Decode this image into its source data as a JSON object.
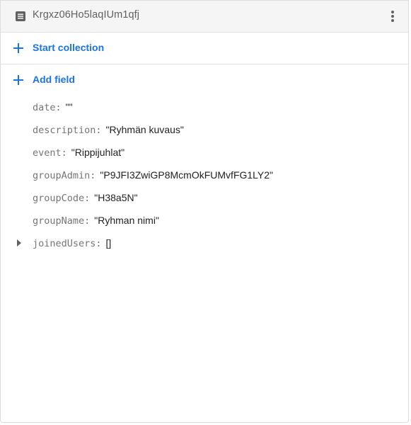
{
  "document": {
    "id": "Krgxz06Ho5laqIUm1qfj"
  },
  "actions": {
    "start_collection": "Start collection",
    "add_field": "Add field"
  },
  "fields": [
    {
      "key": "date:",
      "value": "\"\""
    },
    {
      "key": "description:",
      "value": "\"Ryhmän kuvaus\""
    },
    {
      "key": "event:",
      "value": "\"Rippijuhlat\""
    },
    {
      "key": "groupAdmin:",
      "value": "\"P9JFI3ZwiGP8McmOkFUMvfFG1LY2\""
    },
    {
      "key": "groupCode:",
      "value": "\"H38a5N\""
    },
    {
      "key": "groupName:",
      "value": "\"Ryhman nimi\""
    },
    {
      "key": "joinedUsers:",
      "value": "[]",
      "expandable": true
    }
  ],
  "colors": {
    "accent": "#1a73e8",
    "key_text": "#757575",
    "value_text": "#212121",
    "header_bg": "#f5f5f5"
  },
  "icons": {
    "document": "document-icon",
    "more": "more-vert-icon",
    "add": "plus-icon",
    "expand": "caret-right-icon"
  }
}
